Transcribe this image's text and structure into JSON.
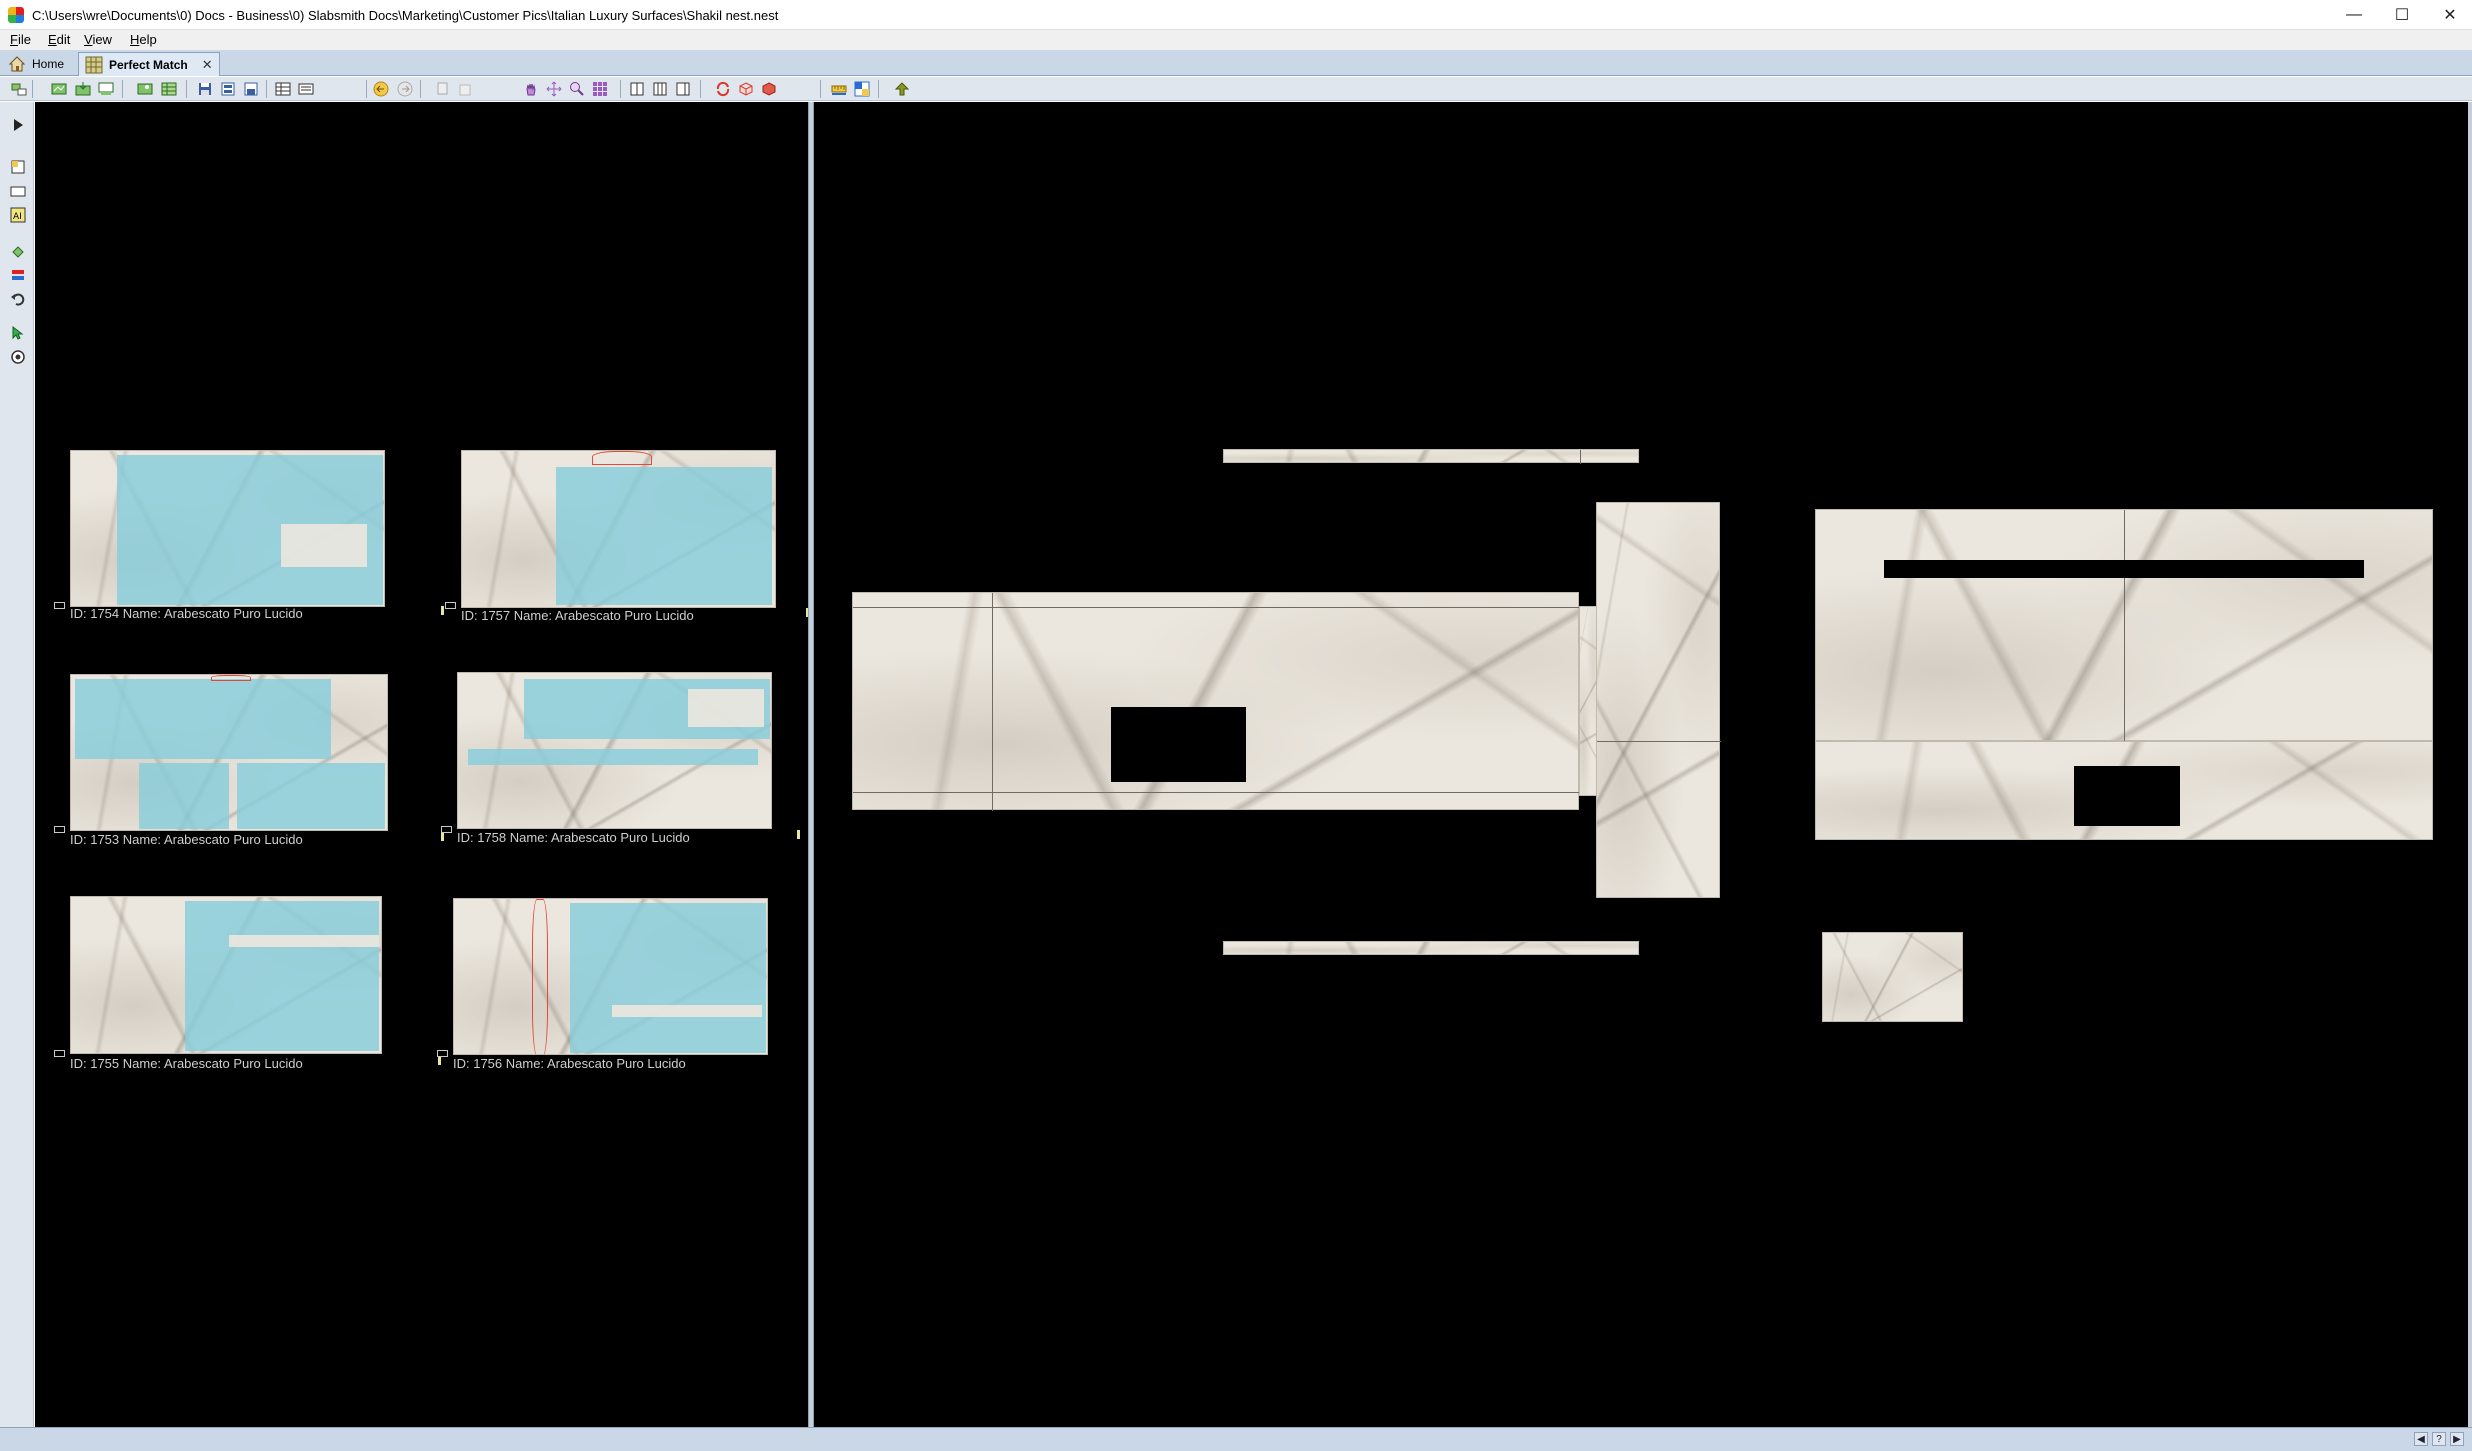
{
  "window": {
    "title": "C:\\Users\\wre\\Documents\\0) Docs - Business\\0) Slabsmith Docs\\Marketing\\Customer Pics\\Italian Luxury Surfaces\\Shakil nest.nest",
    "minimize": "—",
    "maximize": "☐",
    "close": "✕"
  },
  "menu": [
    {
      "first": "F",
      "rest": "ile"
    },
    {
      "first": "E",
      "rest": "dit"
    },
    {
      "first": "V",
      "rest": "iew"
    },
    {
      "first": "H",
      "rest": "elp"
    }
  ],
  "tabs": {
    "home": "Home",
    "perfect_match": "Perfect Match",
    "close": "✕"
  },
  "slabs": [
    {
      "label": "ID: 1754 Name: Arabescato Puro Lucido"
    },
    {
      "label": "ID: 1757 Name: Arabescato Puro Lucido"
    },
    {
      "label": "ID: 1753 Name: Arabescato Puro Lucido"
    },
    {
      "label": "ID: 1758 Name: Arabescato Puro Lucido"
    },
    {
      "label": "ID: 1755 Name: Arabescato Puro Lucido"
    },
    {
      "label": "ID: 1756 Name: Arabescato Puro Lucido"
    }
  ],
  "colors": {
    "panel_background": "#000000",
    "part_highlight": "#87cddc",
    "marble_base": "#ece7de",
    "cut_line": "#e04a3a"
  }
}
